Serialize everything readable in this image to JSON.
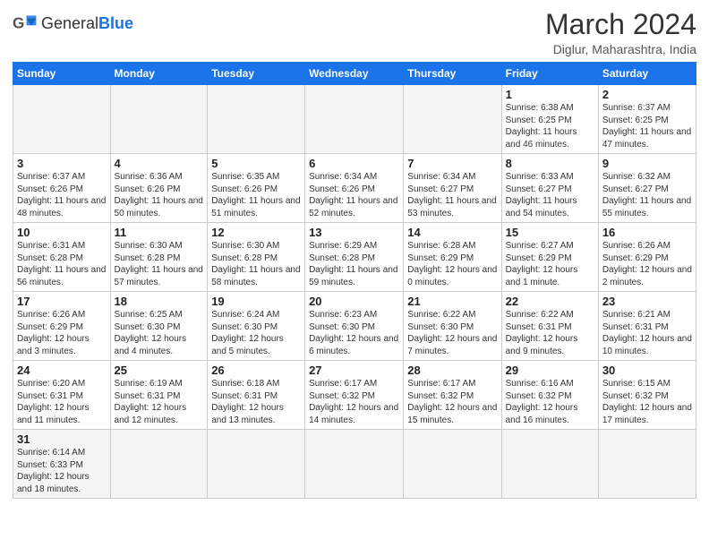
{
  "logo": {
    "text_general": "General",
    "text_blue": "Blue"
  },
  "title": {
    "month_year": "March 2024",
    "location": "Diglur, Maharashtra, India"
  },
  "weekdays": [
    "Sunday",
    "Monday",
    "Tuesday",
    "Wednesday",
    "Thursday",
    "Friday",
    "Saturday"
  ],
  "weeks": [
    [
      {
        "day": "",
        "info": ""
      },
      {
        "day": "",
        "info": ""
      },
      {
        "day": "",
        "info": ""
      },
      {
        "day": "",
        "info": ""
      },
      {
        "day": "",
        "info": ""
      },
      {
        "day": "1",
        "info": "Sunrise: 6:38 AM\nSunset: 6:25 PM\nDaylight: 11 hours and 46 minutes."
      },
      {
        "day": "2",
        "info": "Sunrise: 6:37 AM\nSunset: 6:25 PM\nDaylight: 11 hours and 47 minutes."
      }
    ],
    [
      {
        "day": "3",
        "info": "Sunrise: 6:37 AM\nSunset: 6:26 PM\nDaylight: 11 hours and 48 minutes."
      },
      {
        "day": "4",
        "info": "Sunrise: 6:36 AM\nSunset: 6:26 PM\nDaylight: 11 hours and 50 minutes."
      },
      {
        "day": "5",
        "info": "Sunrise: 6:35 AM\nSunset: 6:26 PM\nDaylight: 11 hours and 51 minutes."
      },
      {
        "day": "6",
        "info": "Sunrise: 6:34 AM\nSunset: 6:26 PM\nDaylight: 11 hours and 52 minutes."
      },
      {
        "day": "7",
        "info": "Sunrise: 6:34 AM\nSunset: 6:27 PM\nDaylight: 11 hours and 53 minutes."
      },
      {
        "day": "8",
        "info": "Sunrise: 6:33 AM\nSunset: 6:27 PM\nDaylight: 11 hours and 54 minutes."
      },
      {
        "day": "9",
        "info": "Sunrise: 6:32 AM\nSunset: 6:27 PM\nDaylight: 11 hours and 55 minutes."
      }
    ],
    [
      {
        "day": "10",
        "info": "Sunrise: 6:31 AM\nSunset: 6:28 PM\nDaylight: 11 hours and 56 minutes."
      },
      {
        "day": "11",
        "info": "Sunrise: 6:30 AM\nSunset: 6:28 PM\nDaylight: 11 hours and 57 minutes."
      },
      {
        "day": "12",
        "info": "Sunrise: 6:30 AM\nSunset: 6:28 PM\nDaylight: 11 hours and 58 minutes."
      },
      {
        "day": "13",
        "info": "Sunrise: 6:29 AM\nSunset: 6:28 PM\nDaylight: 11 hours and 59 minutes."
      },
      {
        "day": "14",
        "info": "Sunrise: 6:28 AM\nSunset: 6:29 PM\nDaylight: 12 hours and 0 minutes."
      },
      {
        "day": "15",
        "info": "Sunrise: 6:27 AM\nSunset: 6:29 PM\nDaylight: 12 hours and 1 minute."
      },
      {
        "day": "16",
        "info": "Sunrise: 6:26 AM\nSunset: 6:29 PM\nDaylight: 12 hours and 2 minutes."
      }
    ],
    [
      {
        "day": "17",
        "info": "Sunrise: 6:26 AM\nSunset: 6:29 PM\nDaylight: 12 hours and 3 minutes."
      },
      {
        "day": "18",
        "info": "Sunrise: 6:25 AM\nSunset: 6:30 PM\nDaylight: 12 hours and 4 minutes."
      },
      {
        "day": "19",
        "info": "Sunrise: 6:24 AM\nSunset: 6:30 PM\nDaylight: 12 hours and 5 minutes."
      },
      {
        "day": "20",
        "info": "Sunrise: 6:23 AM\nSunset: 6:30 PM\nDaylight: 12 hours and 6 minutes."
      },
      {
        "day": "21",
        "info": "Sunrise: 6:22 AM\nSunset: 6:30 PM\nDaylight: 12 hours and 7 minutes."
      },
      {
        "day": "22",
        "info": "Sunrise: 6:22 AM\nSunset: 6:31 PM\nDaylight: 12 hours and 9 minutes."
      },
      {
        "day": "23",
        "info": "Sunrise: 6:21 AM\nSunset: 6:31 PM\nDaylight: 12 hours and 10 minutes."
      }
    ],
    [
      {
        "day": "24",
        "info": "Sunrise: 6:20 AM\nSunset: 6:31 PM\nDaylight: 12 hours and 11 minutes."
      },
      {
        "day": "25",
        "info": "Sunrise: 6:19 AM\nSunset: 6:31 PM\nDaylight: 12 hours and 12 minutes."
      },
      {
        "day": "26",
        "info": "Sunrise: 6:18 AM\nSunset: 6:31 PM\nDaylight: 12 hours and 13 minutes."
      },
      {
        "day": "27",
        "info": "Sunrise: 6:17 AM\nSunset: 6:32 PM\nDaylight: 12 hours and 14 minutes."
      },
      {
        "day": "28",
        "info": "Sunrise: 6:17 AM\nSunset: 6:32 PM\nDaylight: 12 hours and 15 minutes."
      },
      {
        "day": "29",
        "info": "Sunrise: 6:16 AM\nSunset: 6:32 PM\nDaylight: 12 hours and 16 minutes."
      },
      {
        "day": "30",
        "info": "Sunrise: 6:15 AM\nSunset: 6:32 PM\nDaylight: 12 hours and 17 minutes."
      }
    ],
    [
      {
        "day": "31",
        "info": "Sunrise: 6:14 AM\nSunset: 6:33 PM\nDaylight: 12 hours and 18 minutes."
      },
      {
        "day": "",
        "info": ""
      },
      {
        "day": "",
        "info": ""
      },
      {
        "day": "",
        "info": ""
      },
      {
        "day": "",
        "info": ""
      },
      {
        "day": "",
        "info": ""
      },
      {
        "day": "",
        "info": ""
      }
    ]
  ]
}
